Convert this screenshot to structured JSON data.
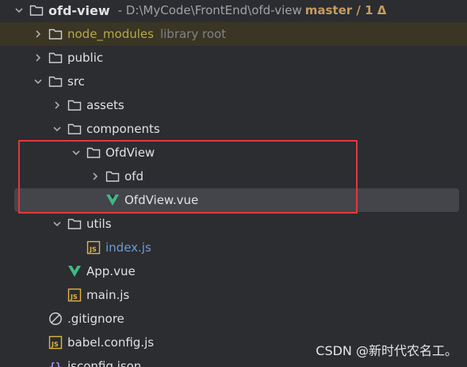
{
  "project": {
    "name": "ofd-view",
    "path": "- D:\\MyCode\\FrontEnd\\ofd-view",
    "vcs": "master / 1 Δ"
  },
  "tree": {
    "node_modules": {
      "label": "node_modules",
      "hint": "library root"
    },
    "public": {
      "label": "public"
    },
    "src": {
      "label": "src"
    },
    "assets": {
      "label": "assets"
    },
    "components": {
      "label": "components"
    },
    "ofdview_dir": {
      "label": "OfdView"
    },
    "ofd": {
      "label": "ofd"
    },
    "ofdview_vue": {
      "label": "OfdView.vue"
    },
    "utils": {
      "label": "utils"
    },
    "index_js": {
      "label": "index.js"
    },
    "app_vue": {
      "label": "App.vue"
    },
    "main_js": {
      "label": "main.js"
    },
    "gitignore": {
      "label": ".gitignore"
    },
    "babel_config": {
      "label": "babel.config.js"
    },
    "jsconfig": {
      "label": "jsconfig.json"
    }
  },
  "icons": {
    "folder": "folder-icon",
    "js": "js-file-icon",
    "vue": "vue-file-icon",
    "ignore": "gitignore-icon",
    "json": "json-file-icon"
  },
  "colors": {
    "background": "#2b2d30",
    "selection": "#43454a",
    "ignored_row": "#3a3524",
    "annotation": "#e0383e",
    "vue_green": "#41b883",
    "js_yellow": "#e3b341",
    "modified_blue": "#6c9bd8"
  },
  "watermark": "CSDN @新时代农名工。"
}
